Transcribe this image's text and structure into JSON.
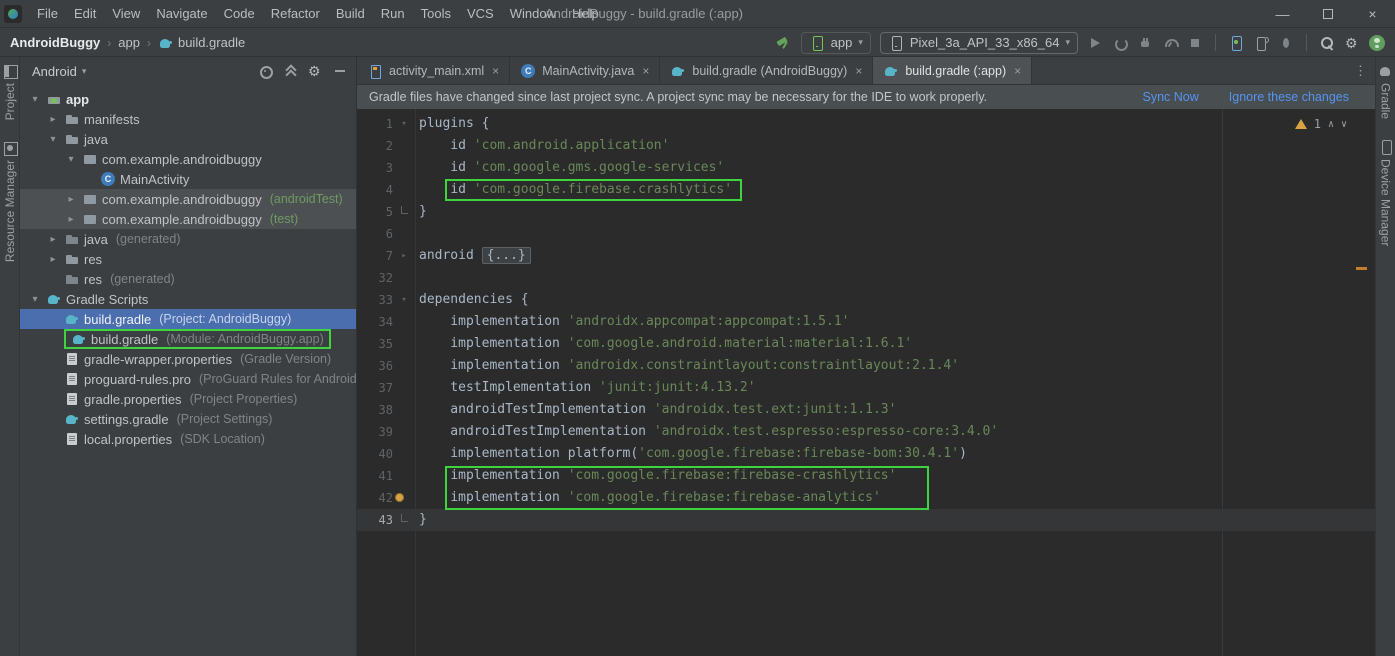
{
  "titlebar": {
    "menu": [
      "File",
      "Edit",
      "View",
      "Navigate",
      "Code",
      "Refactor",
      "Build",
      "Run",
      "Tools",
      "VCS",
      "Window",
      "Help"
    ],
    "title": "AndroidBuggy - build.gradle (:app)",
    "window_controls": [
      "minimize",
      "maximize",
      "close"
    ]
  },
  "toolbar": {
    "breadcrumbs": [
      "AndroidBuggy",
      "app",
      "build.gradle"
    ],
    "run_config": "app",
    "device": "Pixel_3a_API_33_x86_64",
    "run_actions": [
      "run-icon",
      "apply-changes-icon",
      "attach-debugger-icon",
      "profiler-icon",
      "stop-icon"
    ],
    "tool_actions": [
      "device-manager-icon",
      "pair-device-icon",
      "bug-report-icon"
    ],
    "global_actions": [
      "search-icon",
      "settings-icon",
      "avatar-icon"
    ]
  },
  "stripes": {
    "left": [
      {
        "label": "Project",
        "icon": "project-tool-icon"
      },
      {
        "label": "Resource Manager",
        "icon": "resource-manager-tool-icon"
      }
    ],
    "right": [
      {
        "label": "Gradle",
        "icon": "gradle-tool-icon"
      },
      {
        "label": "Device Manager",
        "icon": "device-tool-icon"
      }
    ]
  },
  "project_panel": {
    "selector": "Android",
    "header_icons": [
      "select-opened-file-icon",
      "collapse-all-icon",
      "settings-icon",
      "hide-panel-icon"
    ],
    "tree": [
      {
        "label": "app",
        "level": 0,
        "arrow": "down",
        "icon": "folder-android-icon",
        "bold": true
      },
      {
        "label": "manifests",
        "level": 1,
        "arrow": "right",
        "icon": "folder-icon"
      },
      {
        "label": "java",
        "level": 1,
        "arrow": "down",
        "icon": "folder-icon"
      },
      {
        "label": "com.example.androidbuggy",
        "level": 2,
        "arrow": "down",
        "icon": "package-icon"
      },
      {
        "label": "MainActivity",
        "level": 3,
        "arrow": "none",
        "icon": "class-icon"
      },
      {
        "label": "com.example.androidbuggy",
        "suffix": "(androidTest)",
        "sfx": "suffix-green",
        "level": 2,
        "arrow": "right",
        "icon": "package-icon",
        "bg": "gray"
      },
      {
        "label": "com.example.androidbuggy",
        "suffix": "(test)",
        "sfx": "suffix-green",
        "level": 2,
        "arrow": "right",
        "icon": "package-icon",
        "bg": "gray"
      },
      {
        "label": "java",
        "suffix": "(generated)",
        "level": 1,
        "arrow": "right",
        "icon": "folder-gen-icon"
      },
      {
        "label": "res",
        "level": 1,
        "arrow": "right",
        "icon": "folder-res-icon"
      },
      {
        "label": "res",
        "suffix": "(generated)",
        "level": 1,
        "arrow": "none",
        "icon": "folder-gen-icon"
      },
      {
        "label": "Gradle Scripts",
        "level": 0,
        "arrow": "down",
        "icon": "gradle-icon"
      },
      {
        "label": "build.gradle",
        "suffix": "(Project: AndroidBuggy)",
        "level": 1,
        "arrow": "none",
        "icon": "gradle-icon",
        "selected": true
      },
      {
        "label": "build.gradle",
        "suffix": "(Module: AndroidBuggy.app)",
        "level": 1,
        "arrow": "none",
        "icon": "gradle-icon",
        "boxed": true
      },
      {
        "label": "gradle-wrapper.properties",
        "suffix": "(Gradle Version)",
        "level": 1,
        "arrow": "none",
        "icon": "props-icon"
      },
      {
        "label": "proguard-rules.pro",
        "suffix": "(ProGuard Rules for AndroidBuggy)",
        "level": 1,
        "arrow": "none",
        "icon": "props-icon"
      },
      {
        "label": "gradle.properties",
        "suffix": "(Project Properties)",
        "level": 1,
        "arrow": "none",
        "icon": "props-icon"
      },
      {
        "label": "settings.gradle",
        "suffix": "(Project Settings)",
        "level": 1,
        "arrow": "none",
        "icon": "gradle-icon"
      },
      {
        "label": "local.properties",
        "suffix": "(SDK Location)",
        "level": 1,
        "arrow": "none",
        "icon": "props-icon"
      }
    ]
  },
  "editor": {
    "tabs": [
      {
        "label": "activity_main.xml",
        "icon": "layout-icon",
        "active": false
      },
      {
        "label": "MainActivity.java",
        "icon": "class-icon",
        "active": false
      },
      {
        "label": "build.gradle (AndroidBuggy)",
        "icon": "gradle-icon",
        "active": false
      },
      {
        "label": "build.gradle (:app)",
        "icon": "gradle-icon",
        "active": true
      }
    ],
    "banner": {
      "message": "Gradle files have changed since last project sync. A project sync may be necessary for the IDE to work properly.",
      "actions": [
        {
          "label": "Sync Now"
        },
        {
          "label": "Ignore these changes"
        }
      ]
    },
    "inspection": {
      "warning_count": "1"
    },
    "lines": [
      {
        "n": "1",
        "fold": "open",
        "tokens": [
          [
            "plugins {",
            "plain"
          ]
        ]
      },
      {
        "n": "2",
        "tokens": [
          [
            "    id ",
            "plain"
          ],
          [
            "'com.android.application'",
            "string"
          ]
        ]
      },
      {
        "n": "3",
        "tokens": [
          [
            "    id ",
            "plain"
          ],
          [
            "'com.google.gms.google-services'",
            "string"
          ]
        ]
      },
      {
        "n": "4",
        "pre": "    ",
        "box": "full",
        "tokens": [
          [
            "id ",
            "plain"
          ],
          [
            "'com.google.firebase.crashlytics'",
            "string"
          ]
        ]
      },
      {
        "n": "5",
        "fold": "end",
        "tokens": [
          [
            "}",
            "plain"
          ]
        ]
      },
      {
        "n": "6",
        "tokens": []
      },
      {
        "n": "7",
        "fold": "closed",
        "tokens": [
          [
            "android ",
            "plain"
          ],
          [
            "{...}",
            "fold"
          ]
        ]
      },
      {
        "n": "32",
        "tokens": []
      },
      {
        "n": "33",
        "fold": "open",
        "tokens": [
          [
            "dependencies {",
            "plain"
          ]
        ]
      },
      {
        "n": "34",
        "tokens": [
          [
            "    implementation ",
            "plain"
          ],
          [
            "'androidx.appcompat:appcompat:1.5.1'",
            "string"
          ]
        ]
      },
      {
        "n": "35",
        "tokens": [
          [
            "    implementation ",
            "plain"
          ],
          [
            "'com.google.android.material:material:1.6.1'",
            "string"
          ]
        ]
      },
      {
        "n": "36",
        "tokens": [
          [
            "    implementation ",
            "plain"
          ],
          [
            "'androidx.constraintlayout:constraintlayout:2.1.4'",
            "string"
          ]
        ]
      },
      {
        "n": "37",
        "tokens": [
          [
            "    testImplementation ",
            "plain"
          ],
          [
            "'junit:junit:4.13.2'",
            "string"
          ]
        ]
      },
      {
        "n": "38",
        "tokens": [
          [
            "    androidTestImplementation ",
            "plain"
          ],
          [
            "'androidx.test.ext:junit:1.1.3'",
            "string"
          ]
        ]
      },
      {
        "n": "39",
        "tokens": [
          [
            "    androidTestImplementation ",
            "plain"
          ],
          [
            "'androidx.test.espresso:espresso-core:3.4.0'",
            "string"
          ]
        ]
      },
      {
        "n": "40",
        "tokens": [
          [
            "    implementation platform(",
            "plain"
          ],
          [
            "'com.google.firebase:firebase-bom:30.4.1'",
            "string"
          ],
          [
            ")",
            "plain"
          ]
        ]
      },
      {
        "n": "41",
        "pre": "    ",
        "box": "top",
        "tokens": [
          [
            "implementation ",
            "plain"
          ],
          [
            "'com.google.firebase:firebase-crashlytics'",
            "string"
          ]
        ]
      },
      {
        "n": "42",
        "pre": "    ",
        "box": "bottom",
        "bulb": true,
        "tokens": [
          [
            "implementation ",
            "plain"
          ],
          [
            "'com.google.firebase:firebase-analytics'",
            "string"
          ]
        ]
      },
      {
        "n": "43",
        "fold": "end",
        "current": true,
        "tokens": [
          [
            "}",
            "plain"
          ]
        ]
      }
    ]
  },
  "glyphs": {
    "chevron_down": "▾",
    "chevron_right": "▸",
    "breadcrumb_separator": "›",
    "close": "×",
    "minimize": "—",
    "combo_arrow": "▾",
    "insp_up": "∧",
    "insp_down": "∨"
  },
  "colors": {
    "annotation_green": "#3fd43f",
    "selection_blue": "#4b6eaf",
    "link_blue": "#5693f2",
    "string_green": "#6a8759",
    "scroll_marker_orange": "#c77d2e"
  }
}
